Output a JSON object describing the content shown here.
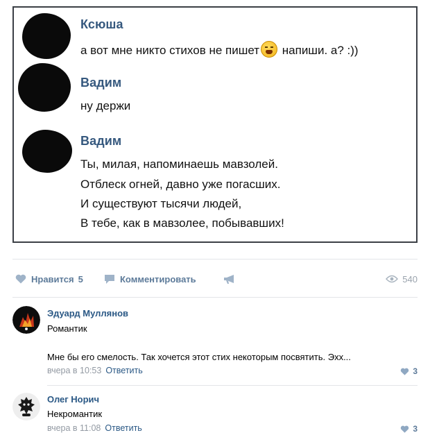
{
  "messages": [
    {
      "author": "Ксюша",
      "lines": [
        "а вот мне никто стихов не пишет",
        "напиши. а? :))"
      ],
      "emoji": "weary-face"
    },
    {
      "author": "Вадим",
      "lines": [
        "ну держи"
      ]
    },
    {
      "author": "Вадим",
      "lines": [
        "Ты, милая, напоминаешь мавзолей.",
        "Отблеск огней, давно уже погасших.",
        "И существуют тысячи людей,",
        "В тебе, как в мавзолее, побывавших!"
      ]
    }
  ],
  "actions": {
    "like_label": "Нравится",
    "like_count": "5",
    "comment_label": "Комментировать",
    "views": "540"
  },
  "comments": [
    {
      "name": "Эдуард Муллянов",
      "text": "Романтик",
      "text2": "Мне бы его смелость. Так хочется этот стих некоторым посвятить. Эхх...",
      "time": "вчера в 10:53",
      "reply": "Ответить",
      "likes": "3"
    },
    {
      "name": "Олег Норич",
      "text": "Некромантик",
      "time": "вчера в 11:08",
      "reply": "Ответить",
      "likes": "3"
    }
  ],
  "colors": {
    "link": "#2a5885",
    "author": "#35587e",
    "muted": "#939aa3",
    "action": "#5c7a99"
  }
}
